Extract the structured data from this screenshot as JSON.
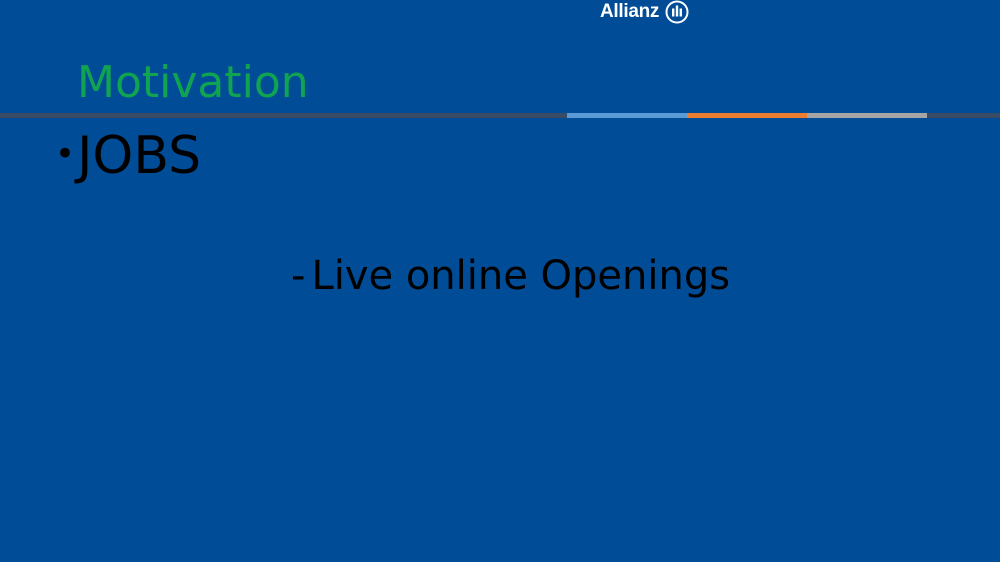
{
  "slide": {
    "background_color": "#004C97",
    "logo": {
      "text": "Allianz",
      "icon": "allianz-eagle-icon"
    },
    "title": "Motivation",
    "title_color": "#0FA352",
    "rule_colors": {
      "base": "#3A4B66",
      "light_blue": "#5B9BD5",
      "orange": "#ED7D31",
      "gray": "#A5A5A5"
    },
    "bullet": {
      "marker": "•",
      "text": "JOBS"
    },
    "subitem": {
      "marker": "-",
      "text": "Live online Openings"
    }
  }
}
